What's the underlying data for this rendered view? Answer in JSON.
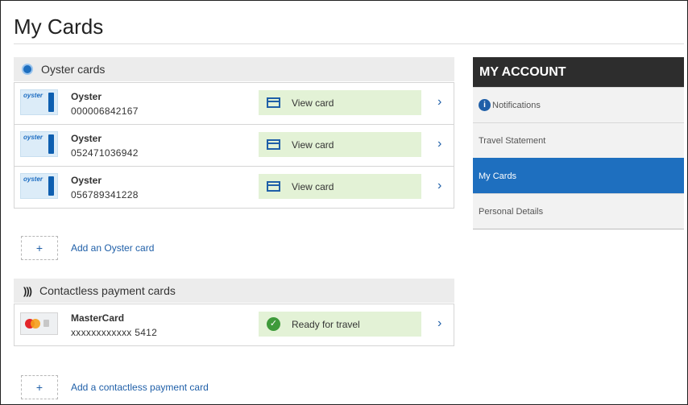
{
  "page": {
    "title": "My Cards"
  },
  "oyster_section": {
    "heading": "Oyster cards",
    "cards": [
      {
        "brand_text": "oyster",
        "name": "Oyster",
        "number": "000006842167",
        "action": "View card"
      },
      {
        "brand_text": "oyster",
        "name": "Oyster",
        "number": "052471036942",
        "action": "View card"
      },
      {
        "brand_text": "oyster",
        "name": "Oyster",
        "number": "056789341228",
        "action": "View card"
      }
    ],
    "add_label": "Add an Oyster card"
  },
  "contactless_section": {
    "heading": "Contactless payment cards",
    "cards": [
      {
        "name": "MasterCard",
        "number": "xxxxxxxxxxxx 5412",
        "status": "Ready for travel"
      }
    ],
    "add_label": "Add a contactless payment card"
  },
  "account_menu": {
    "heading": "MY ACCOUNT",
    "items": [
      {
        "label": "Notifications",
        "icon": "info-icon"
      },
      {
        "label": "Travel Statement"
      },
      {
        "label": "My Cards",
        "active": true
      },
      {
        "label": "Personal Details"
      }
    ]
  },
  "glyphs": {
    "plus": "+",
    "chevron": "›",
    "check": "✓",
    "info": "i",
    "contactless": ")))"
  },
  "colors": {
    "accent": "#1e6fbf",
    "header_dark": "#2d2d2d",
    "status_green": "#e3f2d6",
    "check_green": "#3e9a3a"
  }
}
